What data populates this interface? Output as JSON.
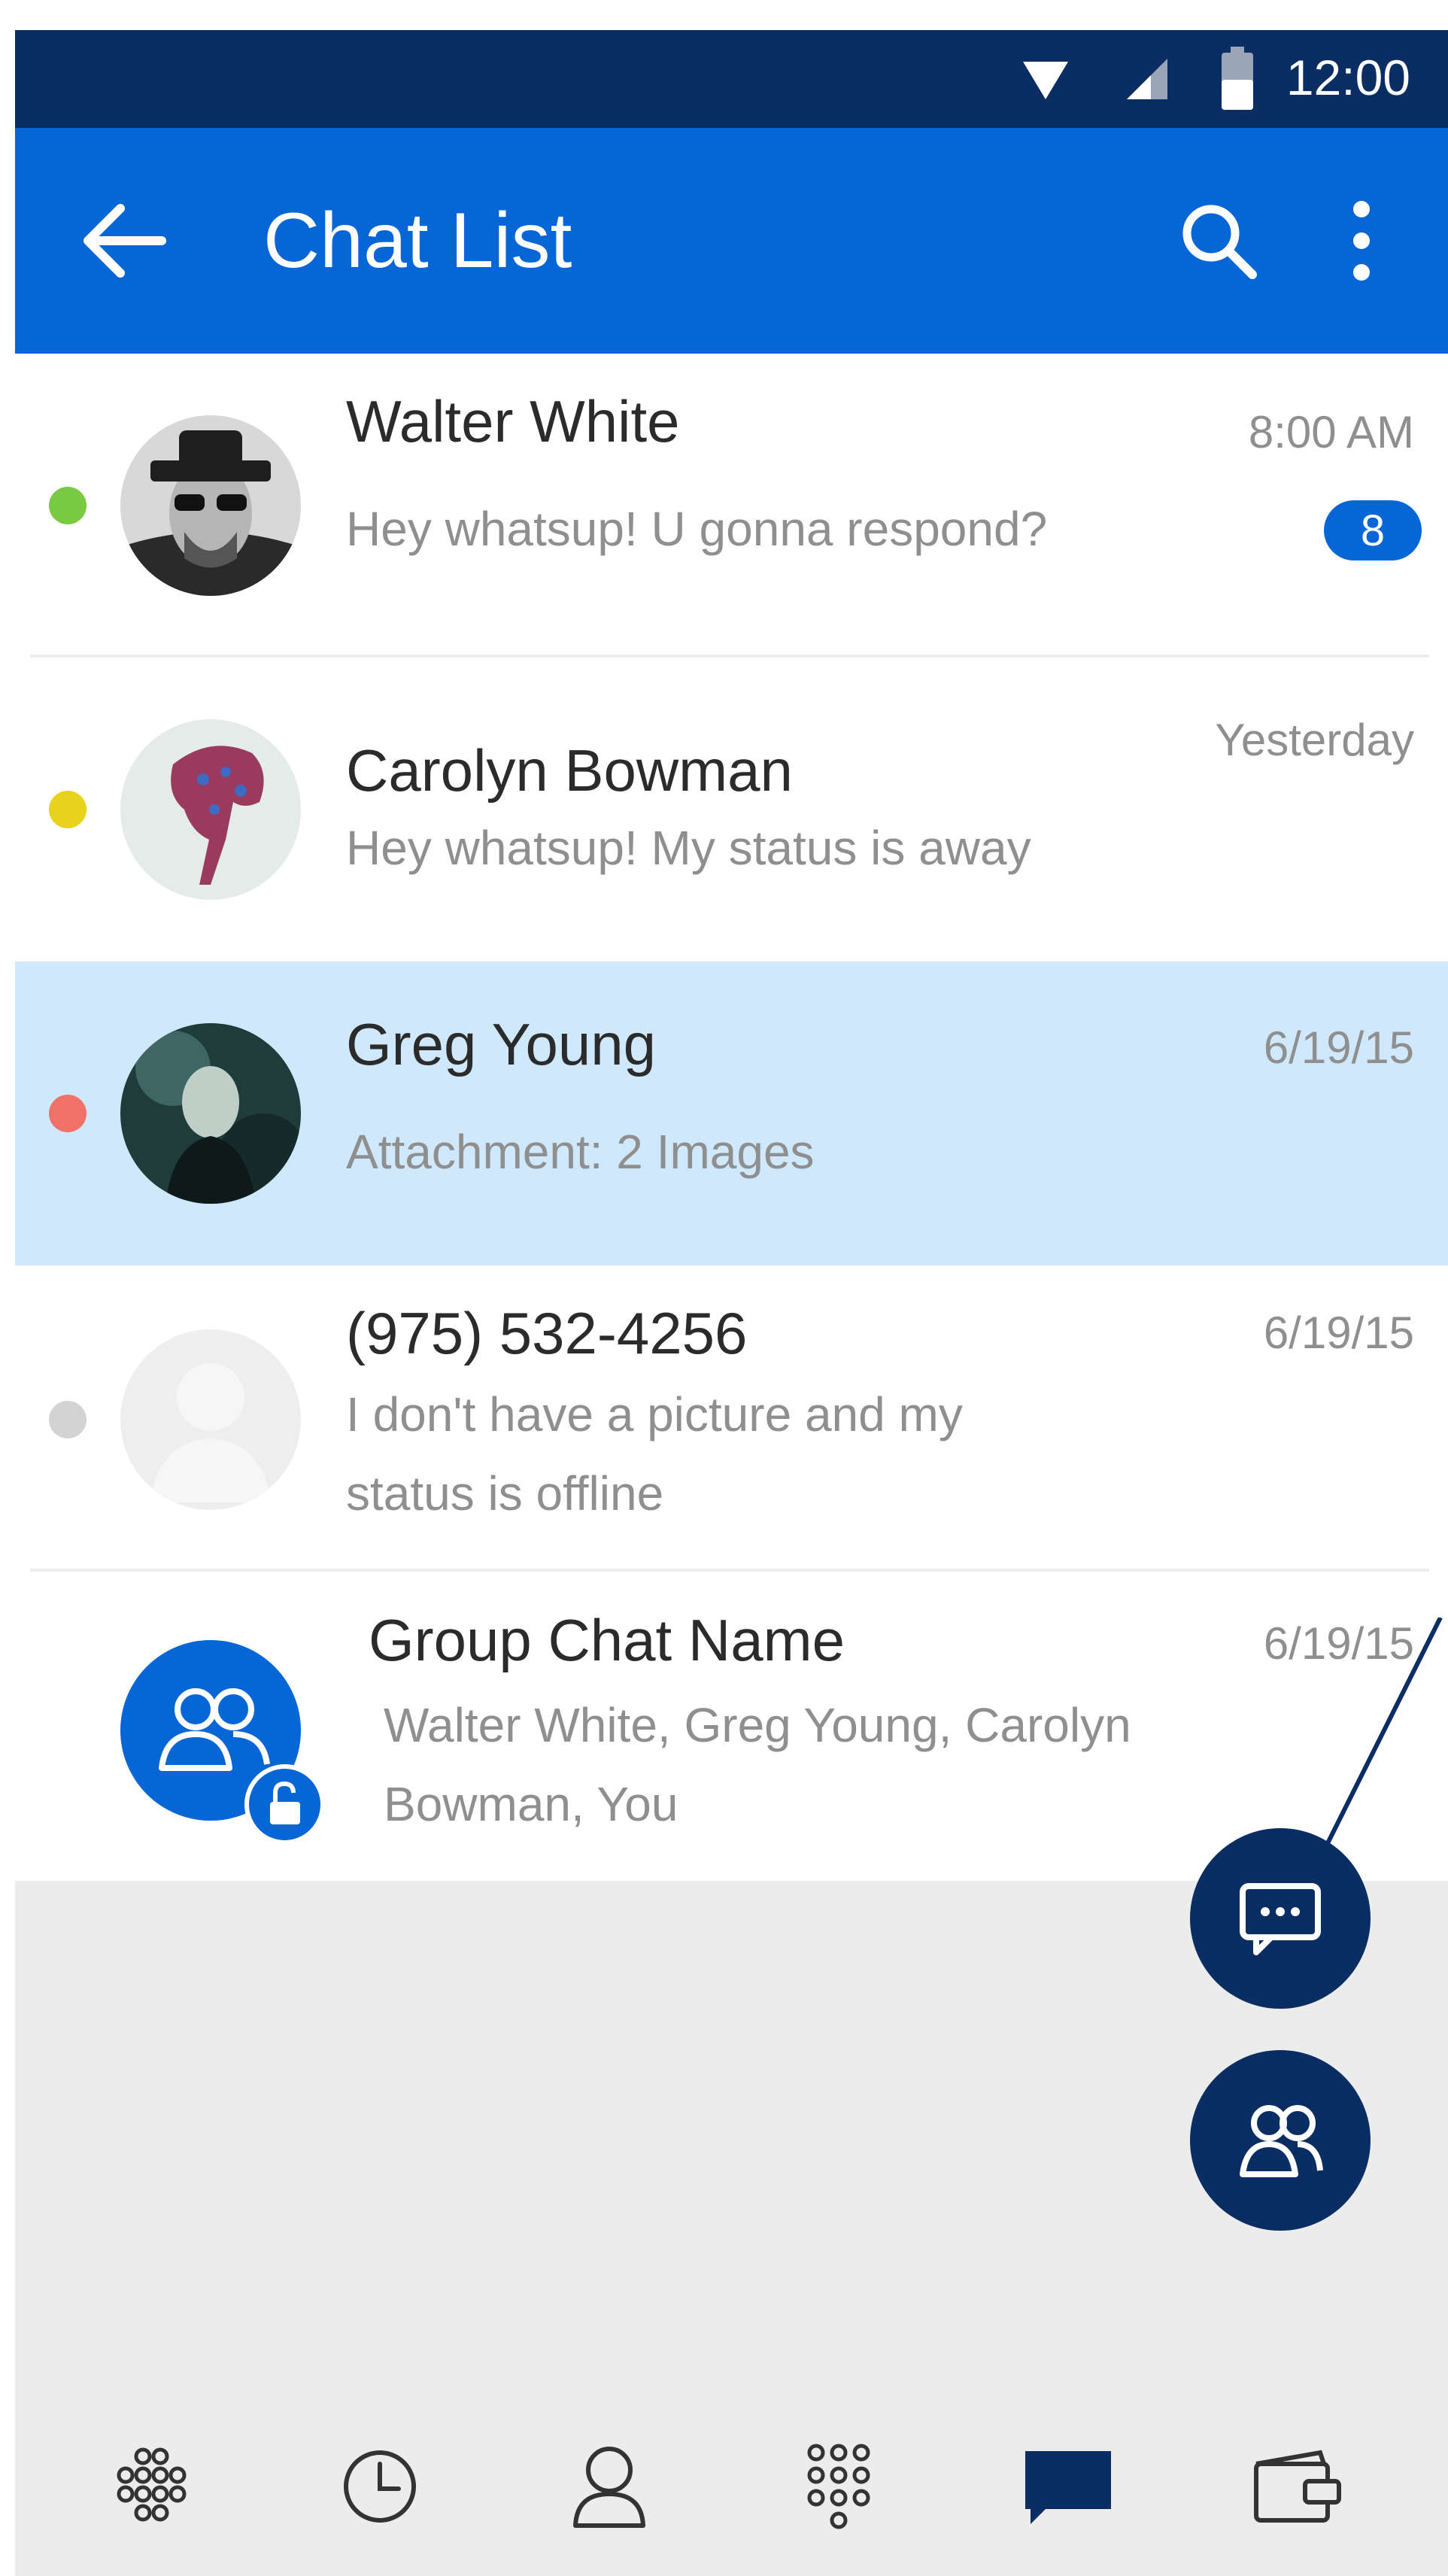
{
  "status_bar": {
    "time": "12:00",
    "icons": [
      "wifi-icon",
      "signal-icon",
      "battery-icon"
    ]
  },
  "app_bar": {
    "title": "Chat List",
    "icons": {
      "back": "arrow-left-icon",
      "search": "search-icon",
      "menu": "more-vert-icon"
    }
  },
  "chats": [
    {
      "name": "Walter White",
      "message": "Hey whatsup! U gonna respond?",
      "time": "8:00 AM",
      "badge": "8",
      "status": "online",
      "status_color": "#7ac943",
      "avatar": "photo"
    },
    {
      "name": "Carolyn Bowman",
      "message": "Hey whatsup! My status is away",
      "time": "Yesterday",
      "status": "away",
      "status_color": "#e8d21c",
      "avatar": "photo"
    },
    {
      "name": "Greg Young",
      "message": "Attachment: 2 Images",
      "time": "6/19/15",
      "status": "busy",
      "status_color": "#f07168",
      "avatar": "photo",
      "selected": true
    },
    {
      "name": "(975) 532-4256",
      "message_line1": "I don't have a picture and my",
      "message_line2": "status is offline",
      "time": "6/19/15",
      "status": "offline",
      "status_color": "#d3d3d3",
      "avatar": "placeholder"
    },
    {
      "name": "Group Chat Name",
      "message_line1": "Walter White, Greg Young, Carolyn",
      "message_line2": "Bowman, You",
      "time": "6/19/15",
      "avatar": "group-icon",
      "lock": "unlock-icon"
    }
  ],
  "fabs": [
    {
      "icon": "new-chat-icon"
    },
    {
      "icon": "new-group-icon"
    }
  ],
  "bottom_nav": [
    {
      "icon": "apps-grid-icon"
    },
    {
      "icon": "clock-icon"
    },
    {
      "icon": "contact-icon"
    },
    {
      "icon": "dialpad-icon"
    },
    {
      "icon": "chat-icon",
      "active": true
    },
    {
      "icon": "wallet-icon"
    }
  ],
  "colors": {
    "primary": "#0766d6",
    "dark": "#0a2d63",
    "selected_row": "#cfe8fb",
    "background": "#ececec"
  }
}
